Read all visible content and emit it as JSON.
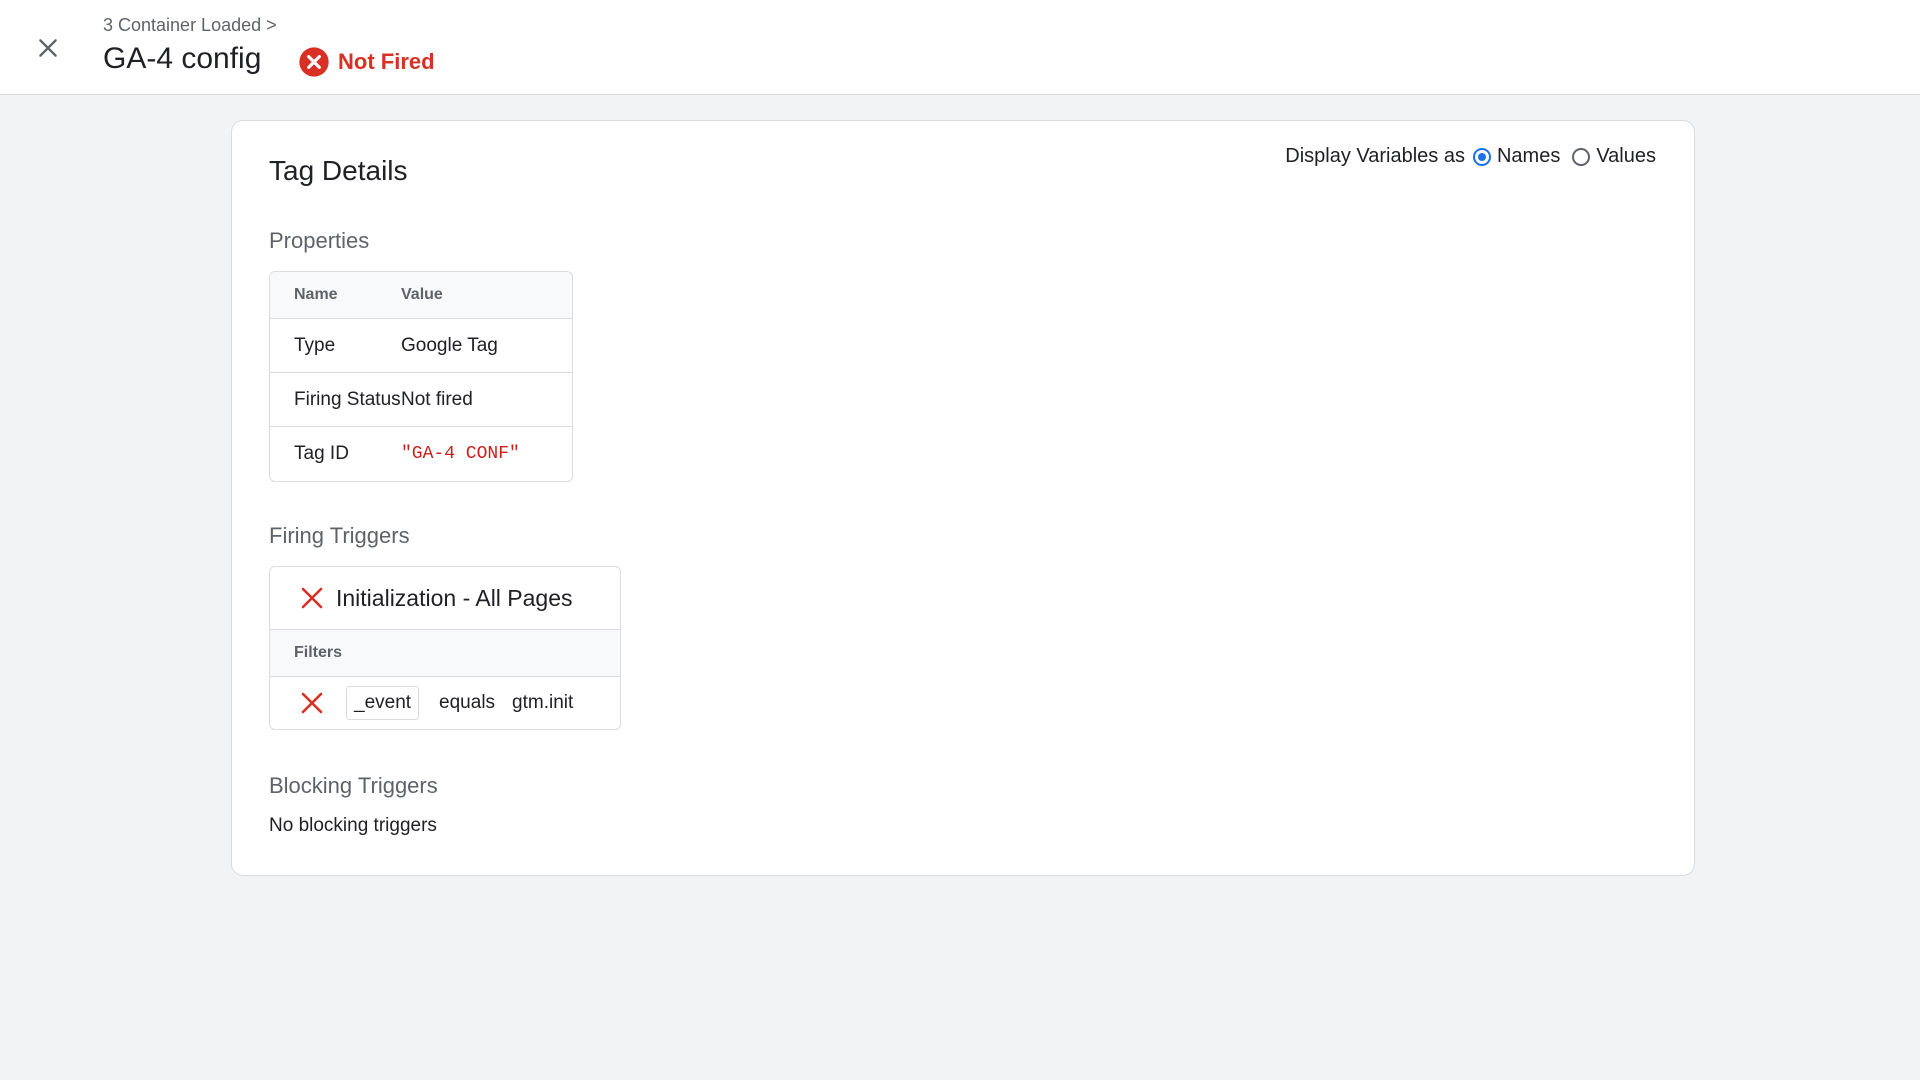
{
  "header": {
    "breadcrumb": "3 Container Loaded >",
    "title": "GA-4 config",
    "status": "Not Fired",
    "status_color": "#d93025",
    "close_icon": "close-icon"
  },
  "card": {
    "title": "Tag Details",
    "display_vars": {
      "label": "Display Variables as",
      "options": [
        "Names",
        "Values"
      ],
      "selected": "Names"
    },
    "properties": {
      "section_title": "Properties",
      "columns": [
        "Name",
        "Value"
      ],
      "rows": [
        {
          "name": "Type",
          "value": "Google Tag"
        },
        {
          "name": "Firing Status",
          "value": "Not fired"
        },
        {
          "name": "Tag ID",
          "value": "\"GA-4 CONF\""
        }
      ]
    },
    "firing_triggers": {
      "section_title": "Firing Triggers",
      "trigger_name": "Initialization - All Pages",
      "filters_label": "Filters",
      "filter": {
        "variable": "_event",
        "operator": "equals",
        "value": "gtm.init"
      }
    },
    "blocking_triggers": {
      "section_title": "Blocking Triggers",
      "empty_text": "No blocking triggers"
    }
  }
}
